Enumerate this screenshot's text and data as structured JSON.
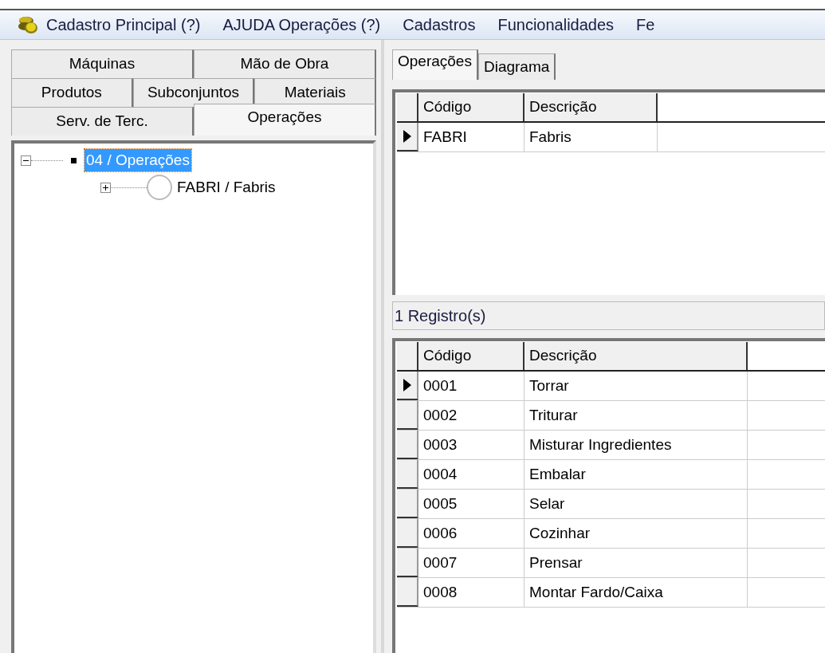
{
  "menu_bar": {
    "items": [
      {
        "label": "Cadastro Principal (?)"
      },
      {
        "label": "AJUDA Operações (?)"
      },
      {
        "label": "Cadastros"
      },
      {
        "label": "Funcionalidades"
      },
      {
        "label": "Fe"
      }
    ]
  },
  "left_tabs": [
    [
      {
        "label": "Máquinas",
        "selected": false
      },
      {
        "label": "Mão de Obra",
        "selected": false
      }
    ],
    [
      {
        "label": "Produtos",
        "selected": false
      },
      {
        "label": "Subconjuntos",
        "selected": false
      },
      {
        "label": "Materiais",
        "selected": false
      }
    ],
    [
      {
        "label": "Serv. de Terc.",
        "selected": false
      },
      {
        "label": "Operações",
        "selected": true
      }
    ]
  ],
  "tree": [
    {
      "label": "04 / Operações",
      "kind": "square",
      "expanded": true,
      "selected": true,
      "children": [
        {
          "label": "FABRI / Fabris",
          "kind": "circle",
          "expanded": false,
          "selected": false
        }
      ]
    }
  ],
  "right_tabs": [
    {
      "label": "Operações",
      "selected": true
    },
    {
      "label": "Diagrama",
      "selected": false
    }
  ],
  "grid_top": {
    "columns": [
      "Código",
      "Descrição"
    ],
    "rows": [
      {
        "cells": [
          "FABRI",
          "Fabris"
        ],
        "current": true
      }
    ]
  },
  "record_count": "1 Registro(s)",
  "grid_bottom": {
    "columns": [
      "Código",
      "Descrição"
    ],
    "rows": [
      {
        "cells": [
          "0001",
          "Torrar"
        ],
        "current": true
      },
      {
        "cells": [
          "0002",
          "Triturar"
        ],
        "current": false
      },
      {
        "cells": [
          "0003",
          "Misturar Ingredientes"
        ],
        "current": false
      },
      {
        "cells": [
          "0004",
          "Embalar"
        ],
        "current": false
      },
      {
        "cells": [
          "0005",
          "Selar"
        ],
        "current": false
      },
      {
        "cells": [
          "0006",
          "Cozinhar"
        ],
        "current": false
      },
      {
        "cells": [
          "0007",
          "Prensar"
        ],
        "current": false
      },
      {
        "cells": [
          "0008",
          "Montar Fardo/Caixa"
        ],
        "current": false
      }
    ]
  }
}
